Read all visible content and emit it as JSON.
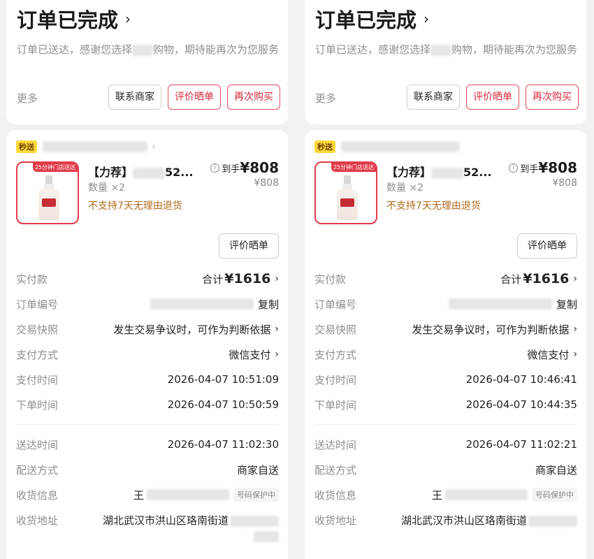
{
  "panels": [
    {
      "status": {
        "title": "订单已完成",
        "desc_before": "订单已送达，感谢您选择",
        "desc_after": "购物，期待能再次为您服务",
        "more": "更多",
        "buttons": [
          "联系商家",
          "评价晒单",
          "再次购买"
        ]
      },
      "order": {
        "badge": "秒送",
        "thumb_tag": "25分钟门店送达",
        "product_title": "【力荐】",
        "product_title_tail": "52...",
        "quantity": "数量 ×2",
        "no_return": "不支持7天无理由退货",
        "arrive_label": "到手",
        "price": "¥808",
        "price_orig": "¥808",
        "rate_button": "评价晒单",
        "rows": [
          {
            "k": "实付款",
            "v_prefix": "合计",
            "v": "¥1616",
            "arrow": true,
            "type": "total"
          },
          {
            "k": "订单编号",
            "v": "复制",
            "type": "orderno"
          },
          {
            "k": "交易快照",
            "v": "发生交易争议时，可作为判断依据",
            "arrow": true
          },
          {
            "k": "支付方式",
            "v": "微信支付",
            "arrow": true
          },
          {
            "k": "支付时间",
            "v": "2026-04-07 10:51:09"
          },
          {
            "k": "下单时间",
            "v": "2026-04-07 10:50:59"
          }
        ],
        "rows2": [
          {
            "k": "送达时间",
            "v": "2026-04-07 11:02:30"
          },
          {
            "k": "配送方式",
            "v": "商家自送"
          },
          {
            "k": "收货信息",
            "v": "王",
            "phone": "号码保护中",
            "type": "phone"
          }
        ],
        "address_label": "收货地址",
        "address": "湖北武汉市洪山区珞南街道"
      }
    },
    {
      "status": {
        "title": "订单已完成",
        "desc_before": "订单已送达，感谢您选择",
        "desc_after": "购物，期待能再次为您服务",
        "more": "更多",
        "buttons": [
          "联系商家",
          "评价晒单",
          "再次购买"
        ]
      },
      "order": {
        "badge": "秒送",
        "thumb_tag": "25分钟门店送达",
        "product_title": "【力荐】",
        "product_title_tail": "52...",
        "quantity": "数量 ×2",
        "no_return": "不支持7天无理由退货",
        "arrive_label": "到手",
        "price": "¥808",
        "price_orig": "¥808",
        "rate_button": "评价晒单",
        "rows": [
          {
            "k": "实付款",
            "v_prefix": "合计",
            "v": "¥1616",
            "arrow": true,
            "type": "total"
          },
          {
            "k": "订单编号",
            "v": "复制",
            "type": "orderno"
          },
          {
            "k": "交易快照",
            "v": "发生交易争议时，可作为判断依据",
            "arrow": true
          },
          {
            "k": "支付方式",
            "v": "微信支付",
            "arrow": true
          },
          {
            "k": "支付时间",
            "v": "2026-04-07 10:46:41"
          },
          {
            "k": "下单时间",
            "v": "2026-04-07 10:44:35"
          }
        ],
        "rows2": [
          {
            "k": "送达时间",
            "v": "2026-04-07 11:02:21"
          },
          {
            "k": "配送方式",
            "v": "商家自送"
          },
          {
            "k": "收货信息",
            "v": "王",
            "phone": "号码保护中",
            "type": "phone"
          }
        ],
        "address_label": "收货地址",
        "address": "湖北武汉市洪山区珞南街道"
      }
    }
  ],
  "colors": {
    "accent": "#e23b4a",
    "badge": "#ffd93b",
    "warning_text": "#b06b1c"
  }
}
